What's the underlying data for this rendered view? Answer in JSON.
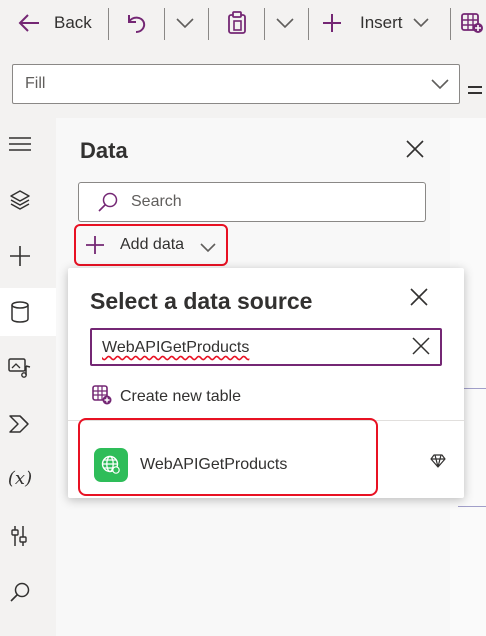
{
  "toolbar": {
    "back_label": "Back",
    "insert_label": "Insert"
  },
  "property_bar": {
    "selected_property": "Fill"
  },
  "left_rail": {
    "icons": [
      "hamburger-icon",
      "layers-icon",
      "plus-icon",
      "database-icon",
      "media-icon",
      "power-automate-icon",
      "variables-icon",
      "advanced-tools-icon",
      "search-icon"
    ],
    "variables_glyph": "(x)"
  },
  "data_pane": {
    "title": "Data",
    "search_placeholder": "Search",
    "add_data_label": "Add data"
  },
  "data_source_dialog": {
    "title": "Select a data source",
    "search_value": "WebAPIGetProducts",
    "create_table_label": "Create new table",
    "results": [
      {
        "label": "WebAPIGetProducts",
        "icon": "globe-icon",
        "premium": true
      }
    ]
  },
  "colors": {
    "accent": "#742774",
    "highlight": "#e81123",
    "connector_green": "#2ebd59"
  }
}
